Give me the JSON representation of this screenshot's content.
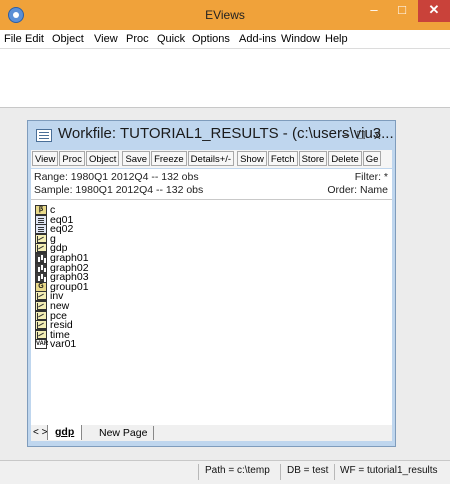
{
  "app": {
    "title": "EViews",
    "colors": {
      "titlebar": "#f0a23a",
      "close": "#c9423a",
      "workfile_frame": "#bfd6ee"
    },
    "icons": {
      "app": "eviews-app-icon",
      "minimize": "minimize-icon",
      "maximize": "maximize-icon",
      "close": "close-icon"
    }
  },
  "menu": [
    "File",
    "Edit",
    "Object",
    "View",
    "Proc",
    "Quick",
    "Options",
    "Add-ins",
    "Window",
    "Help"
  ],
  "workfile": {
    "title": "Workfile: TUTORIAL1_RESULTS - (c:\\users\\viu3...",
    "toolbar": [
      "View",
      "Proc",
      "Object",
      "Save",
      "Freeze",
      "Details+/-",
      "Show",
      "Fetch",
      "Store",
      "Delete",
      "Ge"
    ],
    "range_text": "Range:  1980Q1 2012Q4  --  132 obs",
    "sample_text": "Sample: 1980Q1 2012Q4  --  132 obs",
    "filter_text": "Filter: *",
    "order_text": "Order: Name",
    "objects": [
      {
        "name": "c",
        "type": "coef",
        "icon_text": "β"
      },
      {
        "name": "eq01",
        "type": "eq",
        "icon_text": ""
      },
      {
        "name": "eq02",
        "type": "eq",
        "icon_text": ""
      },
      {
        "name": "g",
        "type": "series",
        "icon_text": ""
      },
      {
        "name": "gdp",
        "type": "series",
        "icon_text": ""
      },
      {
        "name": "graph01",
        "type": "graph",
        "icon_text": ""
      },
      {
        "name": "graph02",
        "type": "graph",
        "icon_text": ""
      },
      {
        "name": "graph03",
        "type": "graph",
        "icon_text": ""
      },
      {
        "name": "group01",
        "type": "group",
        "icon_text": "G"
      },
      {
        "name": "inv",
        "type": "series",
        "icon_text": ""
      },
      {
        "name": "new",
        "type": "series",
        "icon_text": ""
      },
      {
        "name": "pce",
        "type": "series",
        "icon_text": ""
      },
      {
        "name": "resid",
        "type": "series",
        "icon_text": ""
      },
      {
        "name": "time",
        "type": "series",
        "icon_text": ""
      },
      {
        "name": "var01",
        "type": "vec",
        "icon_text": "VAR"
      }
    ],
    "tab_arrows": "< >",
    "active_tab": "gdp",
    "new_page_tab": "New Page",
    "close_glyph": "x",
    "min_glyph": "–",
    "max_glyph": "□"
  },
  "status": {
    "path": "Path = c:\\temp",
    "db": "DB = test",
    "wf": "WF = tutorial1_results"
  }
}
